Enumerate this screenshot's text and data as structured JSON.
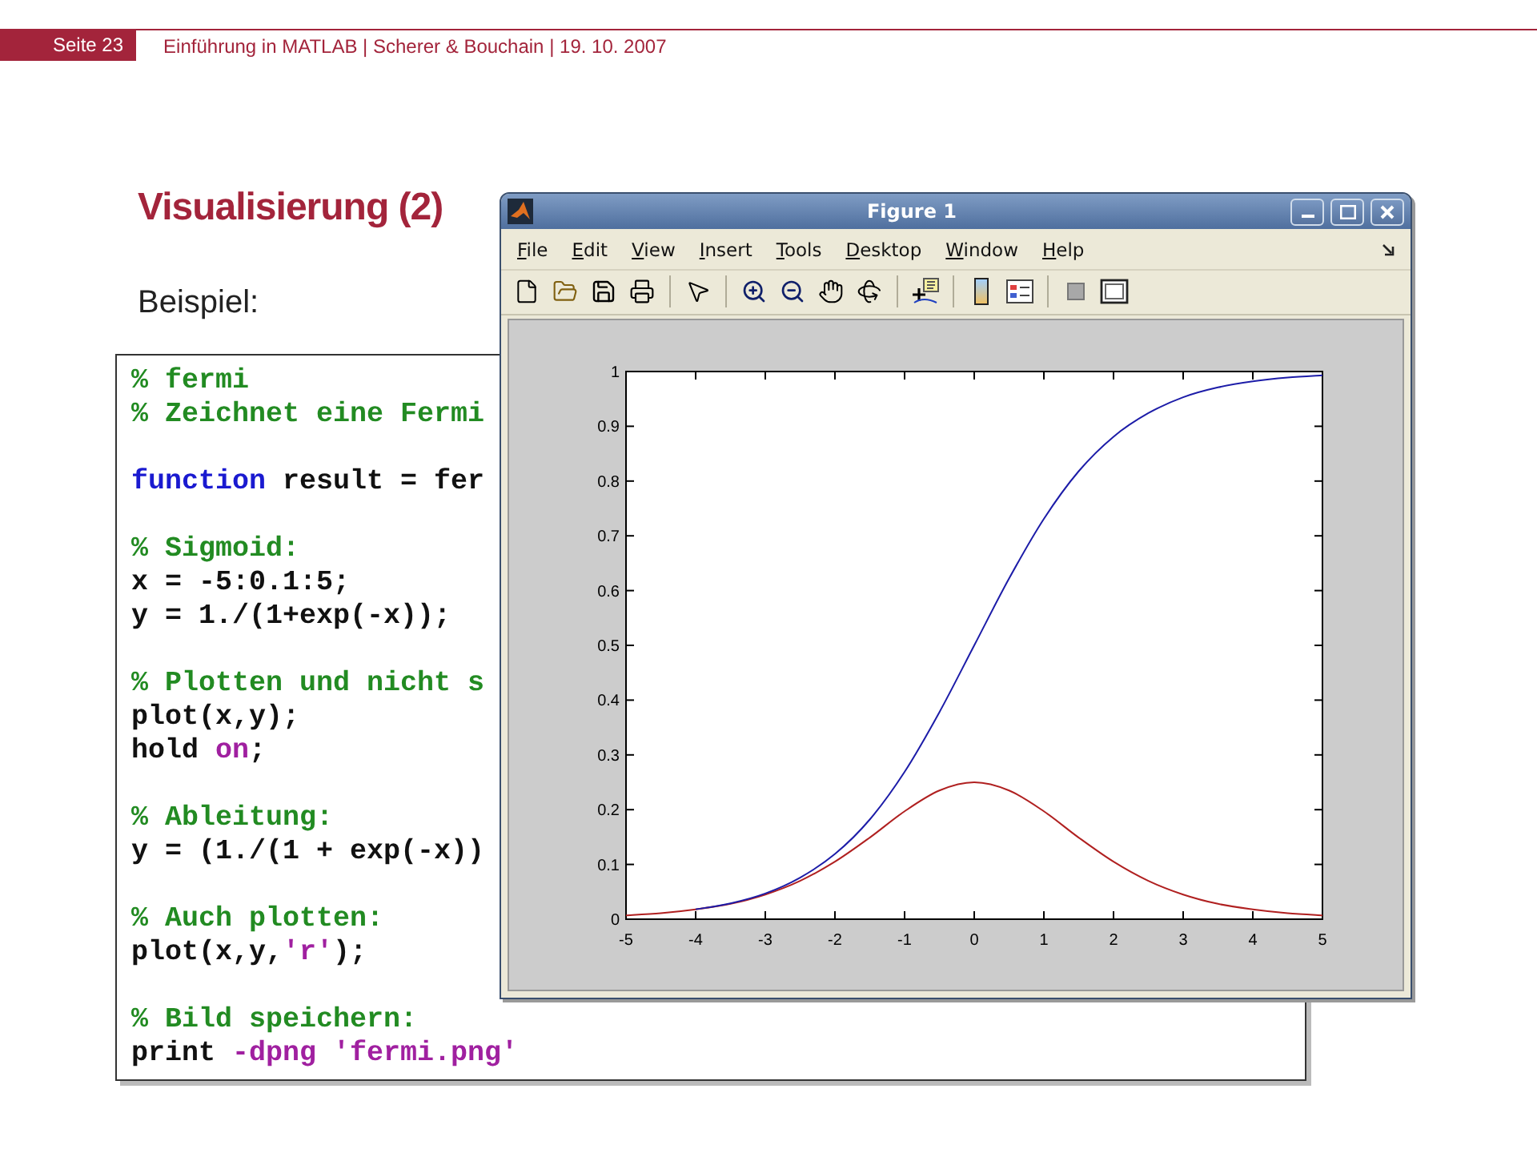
{
  "header": {
    "page": "Seite 23",
    "info": "Einführung in MATLAB | Scherer & Bouchain | 19. 10. 2007"
  },
  "slide": {
    "title": "Visualisierung (2)",
    "subtitle": "Beispiel:"
  },
  "code": {
    "blocks": [
      {
        "lines": [
          [
            {
              "kind": "comment",
              "text": "% fermi"
            }
          ],
          [
            {
              "kind": "comment",
              "text": "% Zeichnet eine Fermi"
            }
          ]
        ]
      },
      {
        "lines": [
          [
            {
              "kind": "keyword",
              "text": "function"
            },
            {
              "kind": "plain",
              "text": " result = fer"
            }
          ]
        ]
      },
      {
        "lines": [
          [
            {
              "kind": "comment",
              "text": "% Sigmoid:"
            }
          ],
          [
            {
              "kind": "plain",
              "text": "x = -5:0.1:5;"
            }
          ],
          [
            {
              "kind": "plain",
              "text": "y = 1./(1+exp(-x));"
            }
          ]
        ]
      },
      {
        "lines": [
          [
            {
              "kind": "comment",
              "text": "% Plotten und nicht s"
            }
          ],
          [
            {
              "kind": "plain",
              "text": "plot(x,y);"
            }
          ],
          [
            {
              "kind": "plain",
              "text": "hold "
            },
            {
              "kind": "string",
              "text": "on"
            },
            {
              "kind": "plain",
              "text": ";"
            }
          ]
        ]
      },
      {
        "lines": [
          [
            {
              "kind": "comment",
              "text": "% Ableitung:"
            }
          ],
          [
            {
              "kind": "plain",
              "text": "y = (1./(1 + exp(-x))"
            }
          ]
        ]
      },
      {
        "lines": [
          [
            {
              "kind": "comment",
              "text": "% Auch plotten:"
            }
          ],
          [
            {
              "kind": "plain",
              "text": "plot(x,y,"
            },
            {
              "kind": "string",
              "text": "'r'"
            },
            {
              "kind": "plain",
              "text": ");"
            }
          ]
        ]
      },
      {
        "lines": [
          [
            {
              "kind": "comment",
              "text": "% Bild speichern:"
            }
          ],
          [
            {
              "kind": "plain",
              "text": "print "
            },
            {
              "kind": "string",
              "text": "-dpng 'fermi.png'"
            }
          ]
        ]
      }
    ]
  },
  "figure": {
    "title": "Figure 1",
    "menu": [
      {
        "label": "File"
      },
      {
        "label": "Edit"
      },
      {
        "label": "View"
      },
      {
        "label": "Insert"
      },
      {
        "label": "Tools"
      },
      {
        "label": "Desktop"
      },
      {
        "label": "Window"
      },
      {
        "label": "Help"
      }
    ],
    "chart_data": {
      "type": "line",
      "x": [
        -5,
        -4.5,
        -4,
        -3.5,
        -3,
        -2.5,
        -2,
        -1.5,
        -1,
        -0.5,
        0,
        0.5,
        1,
        1.5,
        2,
        2.5,
        3,
        3.5,
        4,
        4.5,
        5
      ],
      "series": [
        {
          "color": "#1c1ca8",
          "values": [
            null,
            null,
            0.018,
            0.029,
            0.047,
            0.076,
            0.119,
            0.182,
            0.269,
            0.378,
            0.5,
            0.622,
            0.731,
            0.818,
            0.881,
            0.924,
            0.953,
            0.971,
            0.982,
            0.989,
            0.993
          ]
        },
        {
          "color": "#b02020",
          "values": [
            0.007,
            0.011,
            0.018,
            0.028,
            0.045,
            0.07,
            0.105,
            0.149,
            0.197,
            0.235,
            0.25,
            0.235,
            0.197,
            0.149,
            0.105,
            0.07,
            0.045,
            0.028,
            0.018,
            0.011,
            0.007
          ]
        }
      ],
      "xlim": [
        -5,
        5
      ],
      "ylim": [
        0,
        1
      ],
      "xticks": [
        -5,
        -4,
        -3,
        -2,
        -1,
        0,
        1,
        2,
        3,
        4,
        5
      ],
      "yticks": [
        0,
        0.1,
        0.2,
        0.3,
        0.4,
        0.5,
        0.6,
        0.7,
        0.8,
        0.9,
        1
      ]
    }
  }
}
